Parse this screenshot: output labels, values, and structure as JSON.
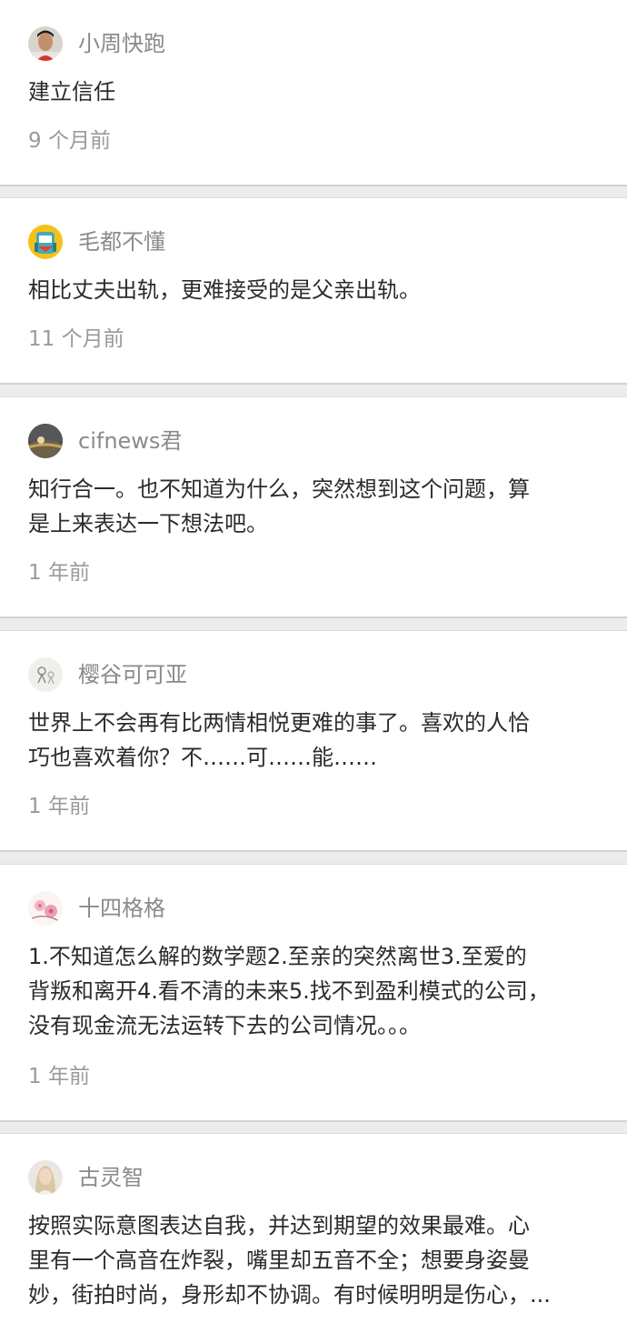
{
  "comments": [
    {
      "username": "小周快跑",
      "avatar": "man-portrait-avatar",
      "lines": [
        "建立信任"
      ],
      "time": "9 个月前"
    },
    {
      "username": "毛都不懂",
      "avatar": "cartoon-avatar",
      "lines": [
        "相比丈夫出轨，更难接受的是父亲出轨。"
      ],
      "time": "11 个月前"
    },
    {
      "username": "cifnews君",
      "avatar": "landscape-avatar",
      "lines": [
        "知行合一。也不知道为什么，突然想到这个问题，算",
        "是上来表达一下想法吧。"
      ],
      "time": "1 年前"
    },
    {
      "username": "樱谷可可亚",
      "avatar": "sketch-avatar",
      "lines": [
        "世界上不会再有比两情相悦更难的事了。喜欢的人恰",
        "巧也喜欢着你？不……可……能……"
      ],
      "time": "1 年前"
    },
    {
      "username": "十四格格",
      "avatar": "flower-avatar",
      "lines": [
        "1.不知道怎么解的数学题2.至亲的突然离世3.至爱的",
        "背叛和离开4.看不清的未来5.找不到盈利模式的公司，",
        "没有现金流无法运转下去的公司情况。。。"
      ],
      "time": "1 年前"
    },
    {
      "username": "古灵智",
      "avatar": "woman-portrait-avatar",
      "lines": [
        "按照实际意图表达自我，并达到期望的效果最难。心",
        "里有一个高音在炸裂，嘴里却五音不全；想要身姿曼",
        "妙，街拍时尚，身形却不协调。有时候明明是伤心，..."
      ],
      "time": ""
    }
  ]
}
